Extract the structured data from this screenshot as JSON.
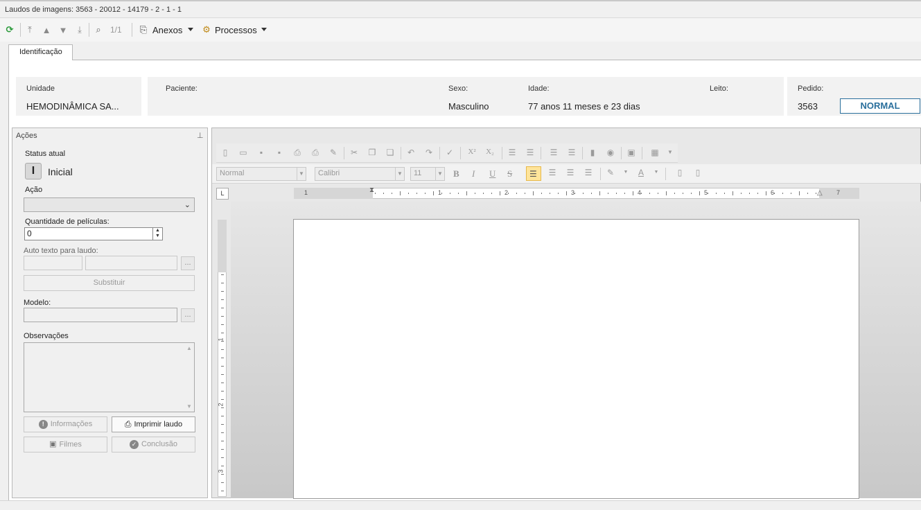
{
  "window": {
    "title": "Laudos de imagens: 3563 - 20012 - 14179 - 2 - 1 - 1"
  },
  "toolbar": {
    "nav_count": "1/1",
    "attachments_label": "Anexos",
    "processes_label": "Processos"
  },
  "tabs": [
    {
      "label": "Identificação"
    }
  ],
  "patient": {
    "unit_label": "Unidade",
    "unit_value": "HEMODINÂMICA SA...",
    "patient_label": "Paciente:",
    "sex_label": "Sexo:",
    "sex_value": "Masculino",
    "age_label": "Idade:",
    "age_value": "77 anos 11 meses  e 23 dias",
    "bed_label": "Leito:",
    "order_label": "Pedido:",
    "order_value": "3563",
    "priority_badge": "NORMAL",
    "priority_color": "#2a6f9c"
  },
  "actions": {
    "title": "Ações",
    "status_label": "Status atual",
    "status_letter": "I",
    "status_value": "Inicial",
    "action_label": "Ação",
    "films_qty_label": "Quantidade de películas:",
    "films_qty_value": "0",
    "autotext_label": "Auto texto para laudo:",
    "replace_button": "Substituir",
    "model_label": "Modelo:",
    "notes_label": "Observações",
    "dots_label": "...",
    "info_button": "Informações",
    "print_button": "Imprimir laudo",
    "films_button": "Filmes",
    "conclusion_button": "Conclusão"
  },
  "editor": {
    "style_value": "Normal",
    "font_value": "Calibri",
    "size_value": "11",
    "bold": "B",
    "italic": "I",
    "underline": "U",
    "strike": "S",
    "superscript": "X²",
    "subscript": "X₂",
    "ruler_marks": [
      "1",
      "1",
      "2",
      "3",
      "4",
      "5",
      "6",
      "7"
    ],
    "vruler_marks": [
      "1",
      "2",
      "3"
    ],
    "highlight_color": "#ffe49a"
  }
}
